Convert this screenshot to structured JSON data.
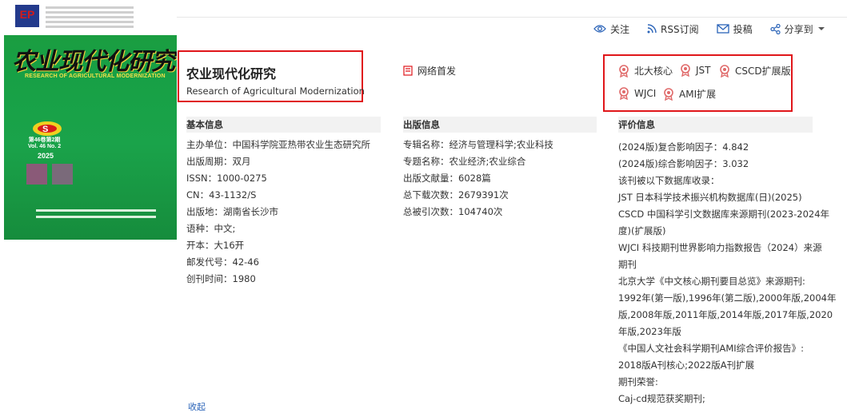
{
  "cover": {
    "publisher_logo": "EP",
    "title": "农业现代化研究",
    "en_title": "RESEARCH OF AGRICULTURAL MODERNIZATION",
    "issue_cn": "第46卷第2期",
    "issue_en": "Vol. 46 No. 2",
    "year": "2025"
  },
  "toolbar": {
    "follow": "关注",
    "rss": "RSS订阅",
    "submit": "投稿",
    "share": "分享到"
  },
  "journal": {
    "title_cn": "农业现代化研究",
    "title_en": "Research of Agricultural Modernization"
  },
  "online_first": "网络首发",
  "tags": [
    "北大核心",
    "JST",
    "CSCD扩展版",
    "WJCI",
    "AMI扩展"
  ],
  "basic": {
    "heading": "基本信息",
    "rows": [
      {
        "k": "主办单位：",
        "v": "中国科学院亚热带农业生态研究所"
      },
      {
        "k": "出版周期：",
        "v": "双月"
      },
      {
        "k": "ISSN：",
        "v": "1000-0275"
      },
      {
        "k": "CN：",
        "v": "43-1132/S"
      },
      {
        "k": "出版地：",
        "v": "湖南省长沙市"
      },
      {
        "k": "语种：",
        "v": "中文;"
      },
      {
        "k": "开本：",
        "v": "大16开"
      },
      {
        "k": "邮发代号：",
        "v": "42-46"
      },
      {
        "k": "创刊时间：",
        "v": "1980"
      }
    ]
  },
  "publish": {
    "heading": "出版信息",
    "rows": [
      {
        "k": "专辑名称：",
        "v": "经济与管理科学;农业科技"
      },
      {
        "k": "专题名称：",
        "v": "农业经济;农业综合"
      },
      {
        "k": "出版文献量：",
        "v": "6028篇"
      },
      {
        "k": "总下载次数：",
        "v": "2679391次"
      },
      {
        "k": "总被引次数：",
        "v": "104740次"
      }
    ]
  },
  "evaluation": {
    "heading": "评价信息",
    "lines": [
      "(2024版)复合影响因子：4.842",
      "(2024版)综合影响因子：3.032",
      "该刊被以下数据库收录：",
      "JST 日本科学技术振兴机构数据库(日)(2025)",
      "CSCD 中国科学引文数据库来源期刊(2023-2024年",
      "度)(扩展版)",
      "WJCI 科技期刊世界影响力指数报告（2024）来源",
      "期刊",
      "北京大学《中文核心期刊要目总览》来源期刊:",
      "1992年(第一版),1996年(第二版),2000年版,2004年",
      "版,2008年版,2011年版,2014年版,2017年版,2020",
      "年版,2023年版",
      "《中国人文社会科学期刊AMI综合评价报告》:",
      "2018版A刊核心;2022版A刊扩展",
      "期刊荣誉:",
      "Caj-cd规范获奖期刊;"
    ]
  },
  "collect": "收起"
}
